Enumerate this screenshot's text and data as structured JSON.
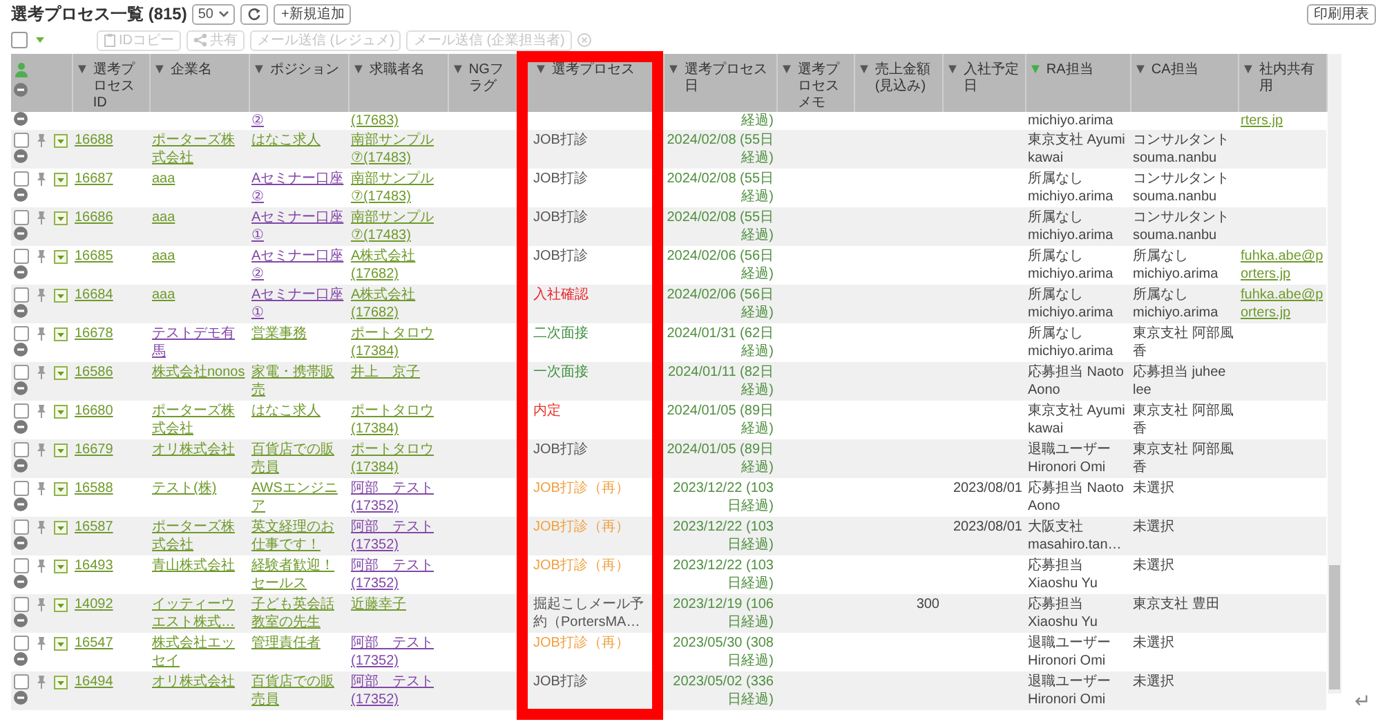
{
  "title": "選考プロセス一覧 (815)",
  "page_size": "50",
  "new_button": "+新規追加",
  "print_button": "印刷用表",
  "select_all": {
    "checked": false
  },
  "toolbar": [
    {
      "kind": "clipboard",
      "label": "IDコピー",
      "disabled": true
    },
    {
      "kind": "share",
      "label": "共有",
      "disabled": true
    },
    {
      "kind": "text",
      "label": "メール送信 (レジュメ)",
      "disabled": true
    },
    {
      "kind": "text",
      "label": "メール送信 (企業担当者)",
      "disabled": true
    }
  ],
  "columns": [
    {
      "arrow": "▼",
      "label": "選考プロセス ID",
      "filtered": false
    },
    {
      "arrow": "▼",
      "label": "企業名",
      "filtered": false
    },
    {
      "arrow": "▼",
      "label": "ポジション",
      "filtered": false
    },
    {
      "arrow": "▼",
      "label": "求職者名",
      "filtered": false
    },
    {
      "arrow": "▼",
      "label": "NGフラグ",
      "filtered": false
    },
    {
      "arrow": "▼",
      "label": "選考プロセス",
      "filtered": false
    },
    {
      "arrow": "▼",
      "label": "選考プロセス日",
      "filtered": false
    },
    {
      "arrow": "▼",
      "label": "選考プロセスメモ",
      "filtered": false
    },
    {
      "arrow": "▼",
      "label": "売上金額(見込み)",
      "filtered": false
    },
    {
      "arrow": "▼",
      "label": "入社予定日",
      "filtered": false
    },
    {
      "arrow": "▼",
      "label": "RA担当",
      "filtered": true
    },
    {
      "arrow": "▼",
      "label": "CA担当",
      "filtered": false
    },
    {
      "arrow": "▼",
      "label": "社内共有用",
      "filtered": false
    }
  ],
  "top_row_partial": {
    "position": {
      "text": "②",
      "visited": true
    },
    "candidate": {
      "text": "(17683)",
      "visited": false
    },
    "date": "経過)",
    "ra": "michiyo.arima",
    "shared": {
      "text": "rters.jp",
      "visited": false
    }
  },
  "rows": [
    {
      "checked": false,
      "id": "16688",
      "company": {
        "text": "ポーターズ株式会社",
        "visited": false
      },
      "position": {
        "text": "はなこ求人",
        "visited": false
      },
      "candidate": {
        "text": "南部サンプル⑦(17483)",
        "visited": false
      },
      "process": {
        "text": "JOB打診",
        "color": "#555555"
      },
      "date": "2024/02/08 (55日経過)",
      "ra": "東京支社 Ayumi kawai",
      "ca": "コンサルタント souma.nanbu"
    },
    {
      "checked": false,
      "id": "16687",
      "company": {
        "text": "aaa",
        "visited": false
      },
      "position": {
        "text": "Aセミナー口座②",
        "visited": true
      },
      "candidate": {
        "text": "南部サンプル⑦(17483)",
        "visited": false
      },
      "process": {
        "text": "JOB打診",
        "color": "#555555"
      },
      "date": "2024/02/08 (55日経過)",
      "ra": "所属なし michiyo.arima",
      "ca": "コンサルタント souma.nanbu"
    },
    {
      "checked": false,
      "id": "16686",
      "company": {
        "text": "aaa",
        "visited": false
      },
      "position": {
        "text": "Aセミナー口座①",
        "visited": true
      },
      "candidate": {
        "text": "南部サンプル⑦(17483)",
        "visited": false
      },
      "process": {
        "text": "JOB打診",
        "color": "#555555"
      },
      "date": "2024/02/08 (55日経過)",
      "ra": "所属なし michiyo.arima",
      "ca": "コンサルタント souma.nanbu"
    },
    {
      "checked": false,
      "id": "16685",
      "company": {
        "text": "aaa",
        "visited": false
      },
      "position": {
        "text": "Aセミナー口座②",
        "visited": true
      },
      "candidate": {
        "text": "A株式会社(17682)",
        "visited": false
      },
      "process": {
        "text": "JOB打診",
        "color": "#555555"
      },
      "date": "2024/02/06 (56日経過)",
      "ra": "所属なし michiyo.arima",
      "ca": "所属なし michiyo.arima",
      "shared": {
        "text": "fuhka.abe@porters.jp",
        "visited": false
      }
    },
    {
      "checked": false,
      "id": "16684",
      "company": {
        "text": "aaa",
        "visited": false
      },
      "position": {
        "text": "Aセミナー口座①",
        "visited": true
      },
      "candidate": {
        "text": "A株式会社(17682)",
        "visited": false
      },
      "process": {
        "text": "入社確認",
        "color": "#e8232a"
      },
      "date": "2024/02/06 (56日経過)",
      "ra": "所属なし michiyo.arima",
      "ca": "所属なし michiyo.arima",
      "shared": {
        "text": "fuhka.abe@porters.jp",
        "visited": false
      }
    },
    {
      "checked": false,
      "id": "16678",
      "company": {
        "text": "テストデモ有馬",
        "visited": true
      },
      "position": {
        "text": "営業事務",
        "visited": false
      },
      "candidate": {
        "text": "ポートタロウ(17384)",
        "visited": false
      },
      "process": {
        "text": "二次面接",
        "color": "#3c8f3c"
      },
      "date": "2024/01/31 (62日経過)",
      "ra": "所属なし michiyo.arima",
      "ca": "東京支社 阿部風香"
    },
    {
      "checked": false,
      "id": "16586",
      "company": {
        "text": "株式会社nonos",
        "visited": false
      },
      "position": {
        "text": "家電・携帯販売",
        "visited": false
      },
      "candidate": {
        "text": "井上　京子",
        "visited": false
      },
      "process": {
        "text": "一次面接",
        "color": "#3c8f3c"
      },
      "date": "2024/01/11 (82日経過)",
      "ra": "応募担当 Naoto Aono",
      "ca": "応募担当 juhee lee"
    },
    {
      "checked": false,
      "id": "16680",
      "company": {
        "text": "ポーターズ株式会社",
        "visited": false
      },
      "position": {
        "text": "はなこ求人",
        "visited": false
      },
      "candidate": {
        "text": "ポートタロウ(17384)",
        "visited": false
      },
      "process": {
        "text": "内定",
        "color": "#e8322a"
      },
      "date": "2024/01/05 (89日経過)",
      "ra": "東京支社 Ayumi kawai",
      "ca": "東京支社 阿部風香"
    },
    {
      "checked": false,
      "id": "16679",
      "company": {
        "text": "オリ株式会社",
        "visited": false
      },
      "position": {
        "text": "百貨店での販売員",
        "visited": false
      },
      "candidate": {
        "text": "ポートタロウ(17384)",
        "visited": false
      },
      "process": {
        "text": "JOB打診",
        "color": "#555555"
      },
      "date": "2024/01/05 (89日経過)",
      "ra": "退職ユーザー Hironori Omi",
      "ca": "東京支社 阿部風香"
    },
    {
      "checked": false,
      "id": "16588",
      "company": {
        "text": "テスト(株)",
        "visited": false
      },
      "position": {
        "text": "AWSエンジニア",
        "visited": false
      },
      "candidate": {
        "text": "阿部　テスト(17352)",
        "visited": true
      },
      "process": {
        "text": "JOB打診（再）",
        "color": "#f0a040"
      },
      "date": "2023/12/22 (103日経過)",
      "join_date": "2023/08/01",
      "ra": "応募担当 Naoto Aono",
      "ca": "未選択"
    },
    {
      "checked": false,
      "id": "16587",
      "company": {
        "text": "ポーターズ株式会社",
        "visited": false
      },
      "position": {
        "text": "英文経理のお仕事です！",
        "visited": false
      },
      "candidate": {
        "text": "阿部　テスト(17352)",
        "visited": true
      },
      "process": {
        "text": "JOB打診（再）",
        "color": "#f0a040"
      },
      "date": "2023/12/22 (103日経過)",
      "join_date": "2023/08/01",
      "ra": "大阪支社 masahiro.tan…",
      "ca": "未選択"
    },
    {
      "checked": false,
      "id": "16493",
      "company": {
        "text": "青山株式会社",
        "visited": false
      },
      "position": {
        "text": "経験者歓迎！セールス",
        "visited": false
      },
      "candidate": {
        "text": "阿部　テスト(17352)",
        "visited": true
      },
      "process": {
        "text": "JOB打診（再）",
        "color": "#f0a040"
      },
      "date": "2023/12/22 (103日経過)",
      "ra": "応募担当 Xiaoshu Yu",
      "ca": "未選択"
    },
    {
      "checked": false,
      "id": "14092",
      "company": {
        "text": "イッティーウエスト株式…",
        "visited": false
      },
      "position": {
        "text": "子ども英会話教室の先生",
        "visited": false
      },
      "candidate": {
        "text": "近藤幸子",
        "visited": false
      },
      "process": {
        "text": "掘起こしメール予約（PortersMA…",
        "color": "#555555"
      },
      "date": "2023/12/19 (106日経過)",
      "sales": "300",
      "ra": "応募担当 Xiaoshu Yu",
      "ca": "東京支社 豊田"
    },
    {
      "checked": false,
      "id": "16547",
      "company": {
        "text": "株式会社エッセイ",
        "visited": false
      },
      "position": {
        "text": "管理責任者",
        "visited": false
      },
      "candidate": {
        "text": "阿部　テスト(17352)",
        "visited": true
      },
      "process": {
        "text": "JOB打診（再）",
        "color": "#f0a040"
      },
      "date": "2023/05/30 (308日経過)",
      "ra": "退職ユーザー Hironori Omi",
      "ca": "未選択"
    },
    {
      "checked": false,
      "id": "16494",
      "company": {
        "text": "オリ株式会社",
        "visited": false
      },
      "position": {
        "text": "百貨店での販売員",
        "visited": false
      },
      "candidate": {
        "text": "阿部　テスト(17352)",
        "visited": true
      },
      "process": {
        "text": "JOB打診",
        "color": "#555555"
      },
      "date": "2023/05/02 (336日経過)",
      "ra": "退職ユーザー Hironori Omi",
      "ca": "未選択"
    }
  ],
  "return_mark": "↵"
}
